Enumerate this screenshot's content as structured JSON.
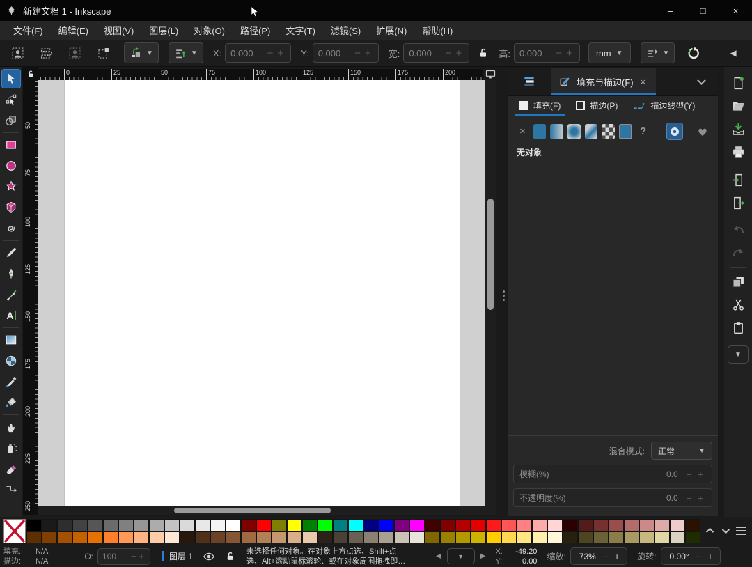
{
  "window": {
    "title": "新建文档 1 - Inkscape",
    "minimize_glyph": "–",
    "maximize_glyph": "□",
    "close_glyph": "×"
  },
  "menubar": {
    "items": [
      {
        "name": "menu-file",
        "label": "文件(F)"
      },
      {
        "name": "menu-edit",
        "label": "编辑(E)"
      },
      {
        "name": "menu-view",
        "label": "视图(V)"
      },
      {
        "name": "menu-layer",
        "label": "图层(L)"
      },
      {
        "name": "menu-object",
        "label": "对象(O)"
      },
      {
        "name": "menu-path",
        "label": "路径(P)"
      },
      {
        "name": "menu-text",
        "label": "文字(T)"
      },
      {
        "name": "menu-filters",
        "label": "滤镜(S)"
      },
      {
        "name": "menu-extensions",
        "label": "扩展(N)"
      },
      {
        "name": "menu-help",
        "label": "帮助(H)"
      }
    ]
  },
  "tool_controls": {
    "select_buttons": [
      {
        "name": "select-all-button",
        "icon": "selall",
        "disabled": false
      },
      {
        "name": "select-all-layers-button",
        "icon": "selalllayers",
        "disabled": false
      },
      {
        "name": "deselect-button",
        "icon": "selall",
        "disabled": true
      },
      {
        "name": "selection-frame-button",
        "icon": "selframe",
        "disabled": false
      }
    ],
    "x_label": "X:",
    "x_value": "0.000",
    "y_label": "Y:",
    "y_value": "0.000",
    "w_label": "宽:",
    "w_value": "0.000",
    "h_label": "高:",
    "h_value": "0.000",
    "units": "mm",
    "dd_arrow": "▼",
    "collapse_glyph": "◀",
    "minus": "−",
    "plus": "+"
  },
  "toolbox": {
    "tools": [
      {
        "name": "selector-tool",
        "icon": "cursor",
        "selected": true
      },
      {
        "name": "node-tool",
        "icon": "node"
      },
      {
        "name": "shape-builder-tool",
        "icon": "shapebuilder"
      },
      {
        "sep": true
      },
      {
        "name": "rectangle-tool",
        "icon": "rect"
      },
      {
        "name": "ellipse-tool",
        "icon": "ellipse"
      },
      {
        "name": "star-tool",
        "icon": "star"
      },
      {
        "name": "box3d-tool",
        "icon": "box3d"
      },
      {
        "name": "spiral-tool",
        "icon": "spiral"
      },
      {
        "sep": true
      },
      {
        "name": "pencil-tool",
        "icon": "pencil"
      },
      {
        "name": "pen-tool",
        "icon": "pen"
      },
      {
        "name": "calligraphy-tool",
        "icon": "calligraphy"
      },
      {
        "name": "text-tool",
        "icon": "text"
      },
      {
        "sep": true
      },
      {
        "name": "gradient-tool",
        "icon": "gradient"
      },
      {
        "name": "mesh-tool",
        "icon": "mesh"
      },
      {
        "name": "dropper-tool",
        "icon": "dropper"
      },
      {
        "name": "paint-bucket-tool",
        "icon": "bucket"
      },
      {
        "sep": true
      },
      {
        "name": "tweak-tool",
        "icon": "tweak"
      },
      {
        "name": "spray-tool",
        "icon": "spray"
      },
      {
        "name": "eraser-tool",
        "icon": "eraser"
      },
      {
        "name": "connector-tool",
        "icon": "connector"
      }
    ]
  },
  "rulers": {
    "top_labels": [
      "0",
      "25",
      "50",
      "75",
      "100",
      "125",
      "150",
      "175",
      "200"
    ],
    "left_labels": [
      "50",
      "75",
      "100",
      "125",
      "150",
      "175",
      "200",
      "225",
      "250"
    ]
  },
  "dock": {
    "fill_stroke_tab": "填充与描边(F)",
    "close_glyph": "×",
    "subtabs": [
      {
        "name": "tab-fill",
        "label": "填充(F)",
        "icon": "fillsq",
        "active": true
      },
      {
        "name": "tab-stroke-paint",
        "label": "描边(P)",
        "icon": "strokesq",
        "active": false
      },
      {
        "name": "tab-stroke-style",
        "label": "描边线型(Y)",
        "icon": "dashes",
        "active": false
      }
    ],
    "fill_types": [
      {
        "name": "no-paint-button",
        "type": "glyph",
        "glyph": "×"
      },
      {
        "name": "flat-color-button",
        "type": "flat"
      },
      {
        "name": "linear-gradient-button",
        "type": "linear"
      },
      {
        "name": "radial-gradient-button",
        "type": "radial"
      },
      {
        "name": "mesh-gradient-button",
        "type": "mesh"
      },
      {
        "name": "pattern-button",
        "type": "pattern"
      },
      {
        "name": "swatch-button",
        "type": "swatchsq"
      },
      {
        "name": "unknown-paint-button",
        "type": "qmark",
        "glyph": "?"
      }
    ],
    "no_object": "无对象",
    "blend_label": "混合模式:",
    "blend_value": "正常",
    "blur_label": "模糊(%)",
    "blur_value": "0.0",
    "opacity_label": "不透明度(%)",
    "opacity_value": "0.0",
    "minus": "−",
    "plus": "+",
    "dd_arrow": "▼"
  },
  "command_bar": {
    "items": [
      {
        "name": "new-document-button",
        "icon": "new"
      },
      {
        "name": "open-button",
        "icon": "open"
      },
      {
        "name": "save-button",
        "icon": "save"
      },
      {
        "name": "print-button",
        "icon": "print"
      },
      {
        "sep": true
      },
      {
        "name": "import-button",
        "icon": "import"
      },
      {
        "name": "export-button",
        "icon": "export"
      },
      {
        "sep": true
      },
      {
        "name": "undo-button",
        "icon": "undo",
        "disabled": true
      },
      {
        "name": "redo-button",
        "icon": "redo",
        "disabled": true
      },
      {
        "sep": true
      },
      {
        "name": "duplicate-button",
        "icon": "duplicate"
      },
      {
        "name": "cut-button",
        "icon": "cut"
      },
      {
        "name": "paste-button",
        "icon": "paste"
      }
    ],
    "more_glyph": "▼"
  },
  "palette": {
    "row1": [
      "#000000",
      "#1a1a1a",
      "#2e2e2e",
      "#424242",
      "#565656",
      "#6b6b6b",
      "#808080",
      "#969696",
      "#acacac",
      "#c3c3c3",
      "#dadada",
      "#e8e8e8",
      "#f4f4f4",
      "#ffffff",
      "#800000",
      "#ff0000",
      "#808000",
      "#ffff00",
      "#008000",
      "#00ff00",
      "#008080",
      "#00ffff",
      "#000080",
      "#0000ff",
      "#800080",
      "#ff00ff",
      "#400000",
      "#800000",
      "#b30000",
      "#e50000",
      "#ff1a1a",
      "#ff5555",
      "#ff8080",
      "#ffaaaa",
      "#ffd5d5",
      "#2b0000",
      "#551a1a",
      "#773030",
      "#994d4d",
      "#b36b6b",
      "#cc8989",
      "#ddaaaa",
      "#eecccc",
      "#2b1100"
    ],
    "row2": [
      "#5c2e00",
      "#803f00",
      "#a35000",
      "#c46000",
      "#e67100",
      "#ff7f2a",
      "#ff9955",
      "#ffb380",
      "#ffccaa",
      "#ffe6d5",
      "#28170b",
      "#503018",
      "#6b4226",
      "#855634",
      "#9e6a42",
      "#b37f55",
      "#c6966e",
      "#d8ae8b",
      "#e9c9ad",
      "#2b2118",
      "#4a4036",
      "#6a5f53",
      "#8a7f71",
      "#aaa092",
      "#cac2b5",
      "#e8e3d8",
      "#806600",
      "#998000",
      "#b39900",
      "#ccb300",
      "#ffcc00",
      "#ffd94d",
      "#ffe680",
      "#ffefaa",
      "#fff7d5",
      "#26210e",
      "#4d4522",
      "#6b6136",
      "#8a7d4a",
      "#a89a62",
      "#c6b97e",
      "#e0d7a4",
      "#d9d4c2",
      "#1f2b00"
    ]
  },
  "statusbar": {
    "fill_label": "填充:",
    "fill_value": "N/A",
    "stroke_label": "描边:",
    "stroke_value": "N/A",
    "opacity_label": "O:",
    "opacity_value": "100",
    "layer_label": "图层 1",
    "message_line1": "未选择任何对象。在对象上方点选、Shift+点",
    "message_line2": "选、Alt+滚动鼠标滚轮、或在对象周围拖拽即…",
    "prev_glyph": "◀",
    "next_glyph": "▶",
    "dd_glyph": "▼",
    "x_label": "X:",
    "x_value": "-49.20",
    "y_label": "Y:",
    "y_value": "0.00",
    "zoom_label": "缩放:",
    "zoom_value": "73%",
    "rotation_label": "旋转:",
    "rotation_value": "0.00°",
    "minus": "−",
    "plus": "+"
  },
  "colors": {
    "accent_blue": "#1f76c2",
    "selected_tool_bg": "#2563a0",
    "canvas_gray": "#d0d0d0",
    "page_white": "#ffffff",
    "flat_fill_blue": "#2d76a4",
    "layer_mark_blue": "#2a7fd4",
    "green_accent": "#4cae4c",
    "shape_pink": "#e93a9a"
  }
}
